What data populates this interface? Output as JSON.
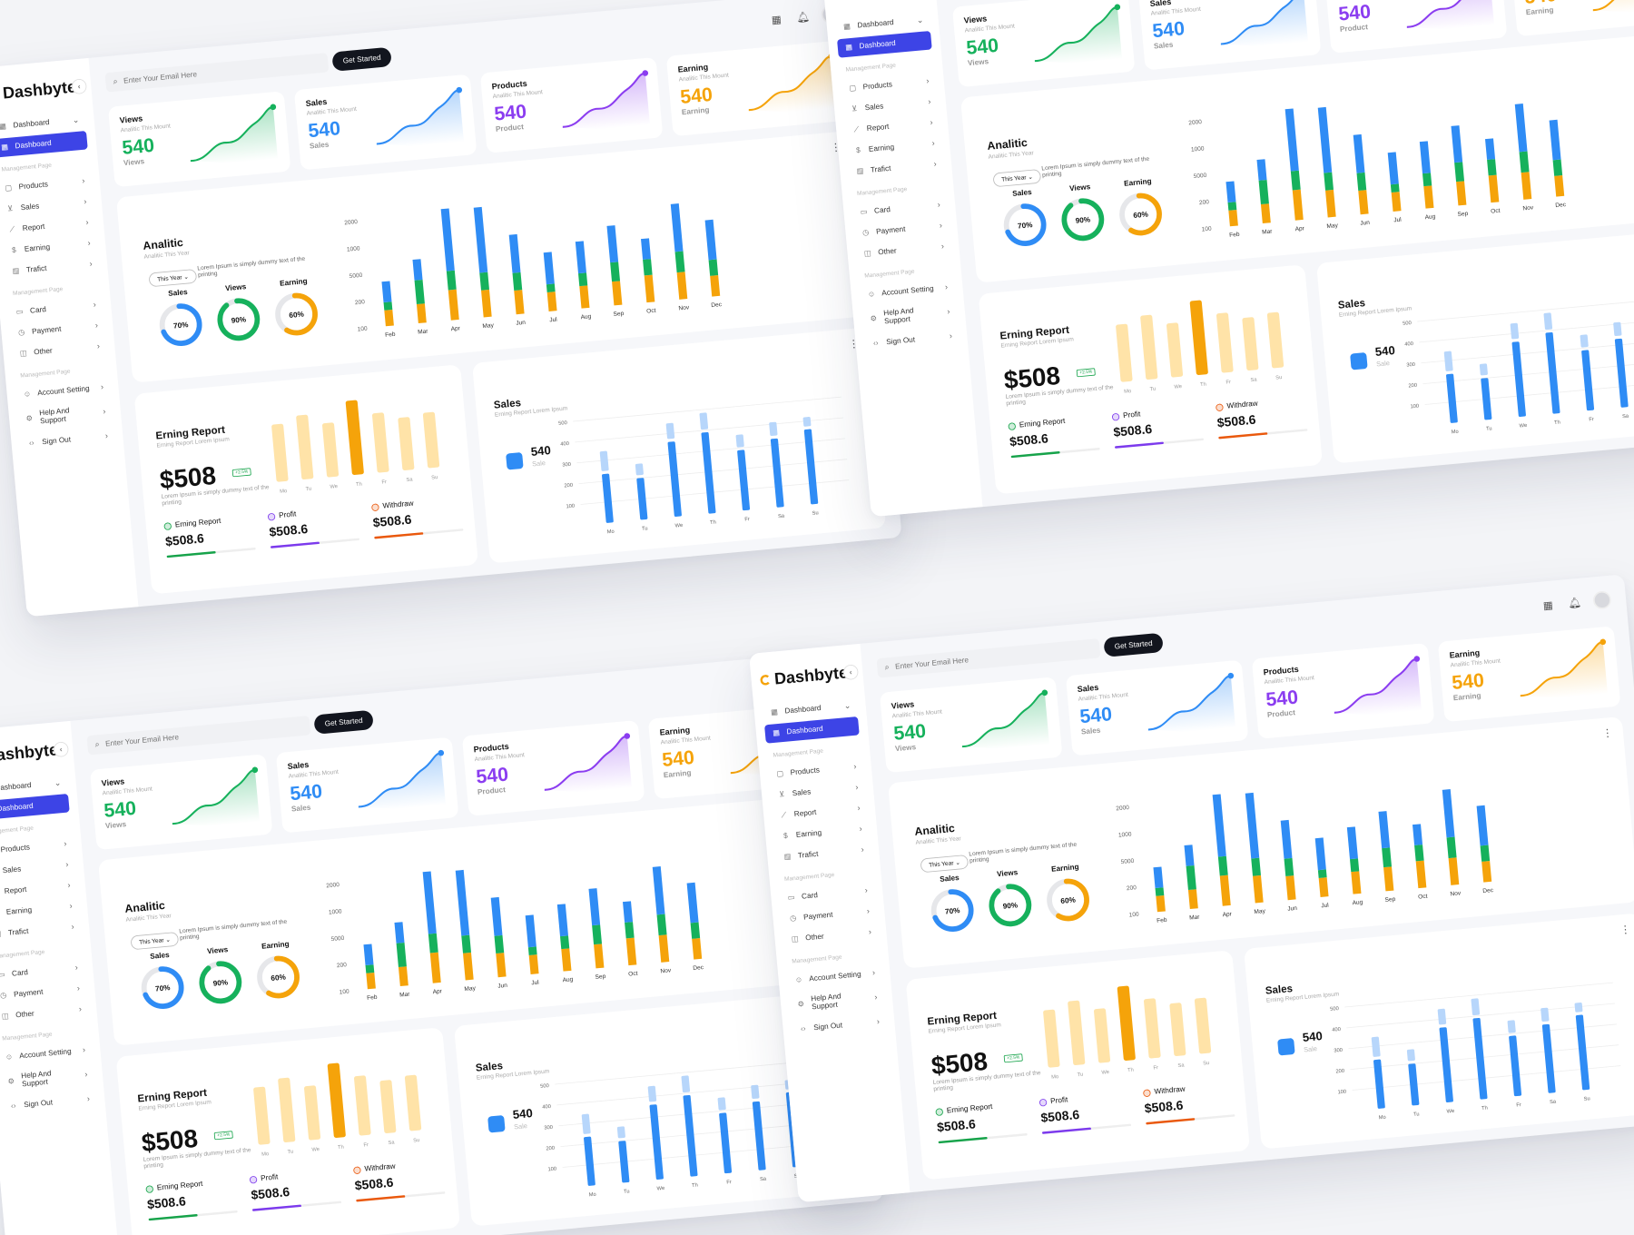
{
  "app": {
    "logo": "Dashbyte",
    "search_placeholder": "Enter Your Email Here",
    "get_started": "Get Started"
  },
  "sidebar": {
    "top_items": [
      {
        "label": "Dashboard",
        "icon": "grid-icon",
        "chevron": "⌄"
      },
      {
        "label": "Dashboard",
        "icon": "grid-icon",
        "active": true
      }
    ],
    "section1": "Management Page",
    "items1": [
      {
        "label": "Products",
        "icon": "bag-icon"
      },
      {
        "label": "Sales",
        "icon": "cart-icon"
      },
      {
        "label": "Report",
        "icon": "chart-line-icon"
      },
      {
        "label": "Earning",
        "icon": "dollar-icon"
      },
      {
        "label": "Trafict",
        "icon": "bars-icon"
      }
    ],
    "section2": "Management Page",
    "items2": [
      {
        "label": "Card",
        "icon": "card-icon"
      },
      {
        "label": "Payment",
        "icon": "payment-icon"
      },
      {
        "label": "Other",
        "icon": "other-icon"
      }
    ],
    "section3": "Management Page",
    "items3": [
      {
        "label": "Account Setting",
        "icon": "user-icon"
      },
      {
        "label": "Help And Support",
        "icon": "gear-icon"
      },
      {
        "label": "Sign Out",
        "icon": "code-icon"
      }
    ]
  },
  "stats": [
    {
      "title": "Views",
      "sub": "Analitic This Mount",
      "value": "540",
      "foot": "Views",
      "color": "#16b15c"
    },
    {
      "title": "Sales",
      "sub": "Analitic This Mount",
      "value": "540",
      "foot": "Sales",
      "color": "#2f8cf5"
    },
    {
      "title": "Products",
      "sub": "Analitic This Mount",
      "value": "540",
      "foot": "Product",
      "color": "#8b3df0"
    },
    {
      "title": "Earning",
      "sub": "Analitic This Mount",
      "value": "540",
      "foot": "Earning",
      "color": "#f5a30a"
    }
  ],
  "analytics": {
    "title": "Analitic",
    "sub": "Analitic This Year",
    "select": "This Year",
    "desc": "Lorem Ipsum is simply dummy text of the printing",
    "gauges": [
      {
        "label": "Sales",
        "percent": 70,
        "text": "70%",
        "color": "#2f8cf5"
      },
      {
        "label": "Views",
        "percent": 90,
        "text": "90%",
        "color": "#16b15c"
      },
      {
        "label": "Earning",
        "percent": 60,
        "text": "60%",
        "color": "#f5a30a"
      }
    ]
  },
  "report": {
    "title": "Erning Report",
    "sub": "Erning Report Lorem Ipsum",
    "amount": "$508",
    "badge": "+2.5%",
    "desc": "Lorem Ipsum is simply dummy text of the printing",
    "stats": [
      {
        "label": "Erning Report",
        "value": "$508.6",
        "color": "#16a34a",
        "fill": 0.55,
        "icon": "report-icon"
      },
      {
        "label": "Profit",
        "value": "$508.6",
        "color": "#7c3aed",
        "fill": 0.55,
        "icon": "profit-icon"
      },
      {
        "label": "Withdraw",
        "value": "$508.6",
        "color": "#ea580c",
        "fill": 0.55,
        "icon": "withdraw-icon"
      }
    ]
  },
  "sales_card": {
    "title": "Sales",
    "sub": "Erning Report Lorem Ipsum",
    "value": "540",
    "label": "Sale"
  },
  "colors": {
    "blue": "#2f8cf5",
    "green": "#16b15c",
    "orange": "#f5a30a",
    "yellow_light": "#ffe3a8",
    "blue_light": "#b7d6fb"
  },
  "chart_data": [
    {
      "type": "bar",
      "stacked": true,
      "categories": [
        "Feb",
        "Mar",
        "Apr",
        "May",
        "Jun",
        "Jul",
        "Aug",
        "Sep",
        "Oct",
        "Nov",
        "Dec"
      ],
      "y_ticks": [
        "100",
        "200",
        "5000",
        "1000",
        "2000"
      ],
      "series": [
        {
          "values": [
            20,
            24,
            38,
            34,
            30,
            24,
            28,
            30,
            34,
            34,
            26
          ],
          "color": "#f5a30a"
        },
        {
          "values": [
            10,
            30,
            24,
            22,
            22,
            10,
            16,
            24,
            20,
            26,
            20
          ],
          "color": "#16b15c"
        },
        {
          "values": [
            26,
            26,
            78,
            82,
            48,
            40,
            40,
            46,
            26,
            60,
            50
          ],
          "color": "#2f8cf5"
        }
      ]
    },
    {
      "type": "bar",
      "categories": [
        "Mo",
        "Tu",
        "We",
        "Th",
        "Fr",
        "Sa",
        "Su"
      ],
      "values": [
        85,
        95,
        80,
        110,
        88,
        78,
        82
      ],
      "highlight_index": 3
    },
    {
      "type": "bar",
      "categories": [
        "Mo",
        "Tu",
        "We",
        "Th",
        "Fr",
        "Sa",
        "Su"
      ],
      "y_ticks": [
        "100",
        "200",
        "300",
        "400",
        "500"
      ],
      "values": [
        235,
        200,
        360,
        390,
        290,
        330,
        360
      ],
      "faded": [
        95,
        55,
        75,
        80,
        60,
        65,
        45
      ]
    }
  ]
}
